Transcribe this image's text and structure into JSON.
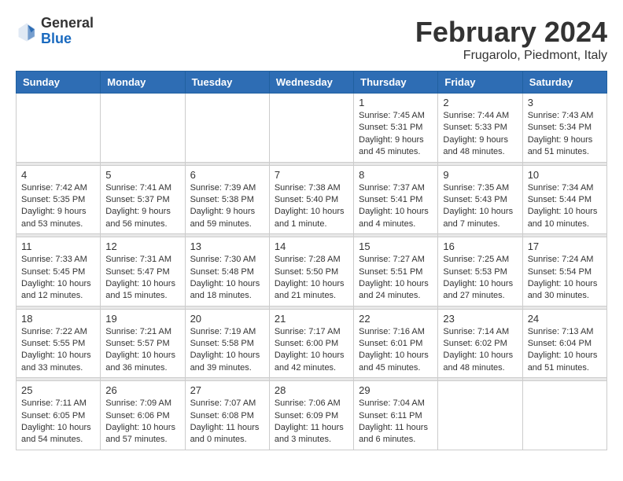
{
  "header": {
    "logo_general": "General",
    "logo_blue": "Blue",
    "month_title": "February 2024",
    "location": "Frugarolo, Piedmont, Italy"
  },
  "days_of_week": [
    "Sunday",
    "Monday",
    "Tuesday",
    "Wednesday",
    "Thursday",
    "Friday",
    "Saturday"
  ],
  "weeks": [
    {
      "cells": [
        {
          "day": "",
          "info": ""
        },
        {
          "day": "",
          "info": ""
        },
        {
          "day": "",
          "info": ""
        },
        {
          "day": "",
          "info": ""
        },
        {
          "day": "1",
          "info": "Sunrise: 7:45 AM\nSunset: 5:31 PM\nDaylight: 9 hours\nand 45 minutes."
        },
        {
          "day": "2",
          "info": "Sunrise: 7:44 AM\nSunset: 5:33 PM\nDaylight: 9 hours\nand 48 minutes."
        },
        {
          "day": "3",
          "info": "Sunrise: 7:43 AM\nSunset: 5:34 PM\nDaylight: 9 hours\nand 51 minutes."
        }
      ]
    },
    {
      "cells": [
        {
          "day": "4",
          "info": "Sunrise: 7:42 AM\nSunset: 5:35 PM\nDaylight: 9 hours\nand 53 minutes."
        },
        {
          "day": "5",
          "info": "Sunrise: 7:41 AM\nSunset: 5:37 PM\nDaylight: 9 hours\nand 56 minutes."
        },
        {
          "day": "6",
          "info": "Sunrise: 7:39 AM\nSunset: 5:38 PM\nDaylight: 9 hours\nand 59 minutes."
        },
        {
          "day": "7",
          "info": "Sunrise: 7:38 AM\nSunset: 5:40 PM\nDaylight: 10 hours\nand 1 minute."
        },
        {
          "day": "8",
          "info": "Sunrise: 7:37 AM\nSunset: 5:41 PM\nDaylight: 10 hours\nand 4 minutes."
        },
        {
          "day": "9",
          "info": "Sunrise: 7:35 AM\nSunset: 5:43 PM\nDaylight: 10 hours\nand 7 minutes."
        },
        {
          "day": "10",
          "info": "Sunrise: 7:34 AM\nSunset: 5:44 PM\nDaylight: 10 hours\nand 10 minutes."
        }
      ]
    },
    {
      "cells": [
        {
          "day": "11",
          "info": "Sunrise: 7:33 AM\nSunset: 5:45 PM\nDaylight: 10 hours\nand 12 minutes."
        },
        {
          "day": "12",
          "info": "Sunrise: 7:31 AM\nSunset: 5:47 PM\nDaylight: 10 hours\nand 15 minutes."
        },
        {
          "day": "13",
          "info": "Sunrise: 7:30 AM\nSunset: 5:48 PM\nDaylight: 10 hours\nand 18 minutes."
        },
        {
          "day": "14",
          "info": "Sunrise: 7:28 AM\nSunset: 5:50 PM\nDaylight: 10 hours\nand 21 minutes."
        },
        {
          "day": "15",
          "info": "Sunrise: 7:27 AM\nSunset: 5:51 PM\nDaylight: 10 hours\nand 24 minutes."
        },
        {
          "day": "16",
          "info": "Sunrise: 7:25 AM\nSunset: 5:53 PM\nDaylight: 10 hours\nand 27 minutes."
        },
        {
          "day": "17",
          "info": "Sunrise: 7:24 AM\nSunset: 5:54 PM\nDaylight: 10 hours\nand 30 minutes."
        }
      ]
    },
    {
      "cells": [
        {
          "day": "18",
          "info": "Sunrise: 7:22 AM\nSunset: 5:55 PM\nDaylight: 10 hours\nand 33 minutes."
        },
        {
          "day": "19",
          "info": "Sunrise: 7:21 AM\nSunset: 5:57 PM\nDaylight: 10 hours\nand 36 minutes."
        },
        {
          "day": "20",
          "info": "Sunrise: 7:19 AM\nSunset: 5:58 PM\nDaylight: 10 hours\nand 39 minutes."
        },
        {
          "day": "21",
          "info": "Sunrise: 7:17 AM\nSunset: 6:00 PM\nDaylight: 10 hours\nand 42 minutes."
        },
        {
          "day": "22",
          "info": "Sunrise: 7:16 AM\nSunset: 6:01 PM\nDaylight: 10 hours\nand 45 minutes."
        },
        {
          "day": "23",
          "info": "Sunrise: 7:14 AM\nSunset: 6:02 PM\nDaylight: 10 hours\nand 48 minutes."
        },
        {
          "day": "24",
          "info": "Sunrise: 7:13 AM\nSunset: 6:04 PM\nDaylight: 10 hours\nand 51 minutes."
        }
      ]
    },
    {
      "cells": [
        {
          "day": "25",
          "info": "Sunrise: 7:11 AM\nSunset: 6:05 PM\nDaylight: 10 hours\nand 54 minutes."
        },
        {
          "day": "26",
          "info": "Sunrise: 7:09 AM\nSunset: 6:06 PM\nDaylight: 10 hours\nand 57 minutes."
        },
        {
          "day": "27",
          "info": "Sunrise: 7:07 AM\nSunset: 6:08 PM\nDaylight: 11 hours\nand 0 minutes."
        },
        {
          "day": "28",
          "info": "Sunrise: 7:06 AM\nSunset: 6:09 PM\nDaylight: 11 hours\nand 3 minutes."
        },
        {
          "day": "29",
          "info": "Sunrise: 7:04 AM\nSunset: 6:11 PM\nDaylight: 11 hours\nand 6 minutes."
        },
        {
          "day": "",
          "info": ""
        },
        {
          "day": "",
          "info": ""
        }
      ]
    }
  ]
}
